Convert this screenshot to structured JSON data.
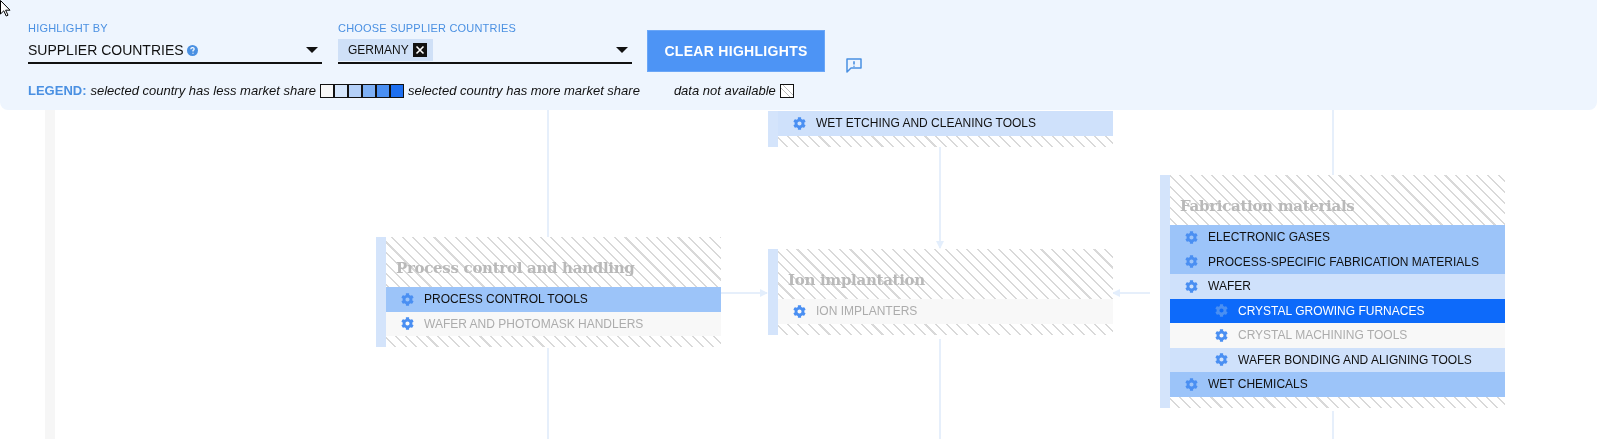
{
  "header": {
    "highlight_by": {
      "label": "HIGHLIGHT BY",
      "value": "SUPPLIER COUNTRIES"
    },
    "countries": {
      "label": "CHOOSE SUPPLIER COUNTRIES",
      "chips": [
        "GERMANY"
      ]
    },
    "clear_button": "CLEAR HIGHLIGHTS",
    "legend": {
      "title": "LEGEND:",
      "less": "selected country has less market share",
      "more": "selected country has more market share",
      "na": "data not available"
    }
  },
  "nodes": [
    {
      "items": [
        {
          "label": "WET ETCHING AND CLEANING TOOLS",
          "color": "#cfe1fb"
        }
      ]
    },
    {
      "title": "Process control and handling",
      "items": [
        {
          "label": "PROCESS CONTROL TOOLS",
          "color": "#9cc4f9"
        },
        {
          "label": "WAFER AND PHOTOMASK HANDLERS",
          "color": "#f8f8f8"
        }
      ]
    },
    {
      "title": "Ion implantation",
      "items": [
        {
          "label": "ION IMPLANTERS",
          "color": "#f8f8f8"
        }
      ]
    },
    {
      "title": "Fabrication materials",
      "items": [
        {
          "label": "ELECTRONIC GASES",
          "color": "#9cc4f9"
        },
        {
          "label": "PROCESS-SPECIFIC FABRICATION MATERIALS",
          "color": "#9cc4f9"
        },
        {
          "label": "WAFER",
          "color": "#cfe1fb",
          "children": [
            {
              "label": "CRYSTAL GROWING FURNACES",
              "color": "#0d6afa"
            },
            {
              "label": "CRYSTAL MACHINING TOOLS",
              "color": "#f8f8f8"
            },
            {
              "label": "WAFER BONDING AND ALIGNING TOOLS",
              "color": "#cfe1fb"
            }
          ]
        },
        {
          "label": "WET CHEMICALS",
          "color": "#9cc4f9"
        }
      ]
    }
  ]
}
